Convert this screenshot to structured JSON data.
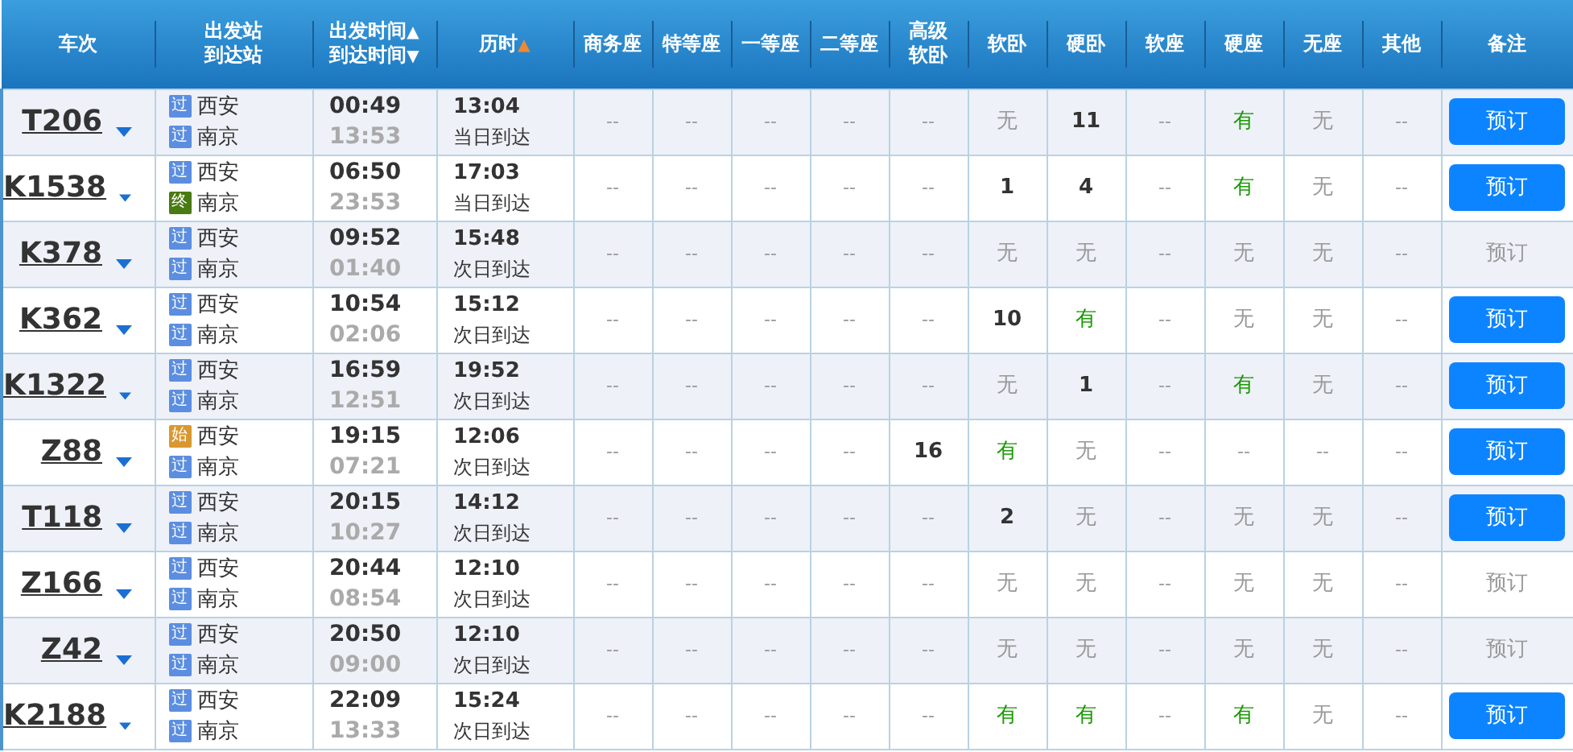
{
  "table": {
    "columns": [
      {
        "lines": [
          {
            "text": "车次"
          }
        ]
      },
      {
        "lines": [
          {
            "text": "出发站"
          },
          {
            "text": "到达站"
          }
        ]
      },
      {
        "lines": [
          {
            "text": "出发时间",
            "sort": "▲",
            "active": false
          },
          {
            "text": "到达时间",
            "sort": "▼",
            "active": false
          }
        ]
      },
      {
        "lines": [
          {
            "text": "历时",
            "sort": "▲",
            "active": true
          }
        ]
      },
      {
        "lines": [
          {
            "text": "商务座"
          }
        ]
      },
      {
        "lines": [
          {
            "text": "特等座"
          }
        ]
      },
      {
        "lines": [
          {
            "text": "一等座"
          }
        ]
      },
      {
        "lines": [
          {
            "text": "二等座"
          }
        ]
      },
      {
        "lines": [
          {
            "text": "高级"
          },
          {
            "text": "软卧"
          }
        ]
      },
      {
        "lines": [
          {
            "text": "软卧"
          }
        ]
      },
      {
        "lines": [
          {
            "text": "硬卧"
          }
        ]
      },
      {
        "lines": [
          {
            "text": "软座"
          }
        ]
      },
      {
        "lines": [
          {
            "text": "硬座"
          }
        ]
      },
      {
        "lines": [
          {
            "text": "无座"
          }
        ]
      },
      {
        "lines": [
          {
            "text": "其他"
          }
        ]
      },
      {
        "lines": [
          {
            "text": "备注"
          }
        ]
      }
    ],
    "rows": [
      {
        "train": "T206",
        "from": {
          "badge": "过",
          "kind": "pass",
          "name": "西安"
        },
        "to": {
          "badge": "过",
          "kind": "pass",
          "name": "南京"
        },
        "depart": "00:49",
        "arrive": "13:53",
        "duration": "13:04",
        "arrival_day": "当日到达",
        "seats": [
          {
            "text": "--",
            "kind": "none"
          },
          {
            "text": "--",
            "kind": "none"
          },
          {
            "text": "--",
            "kind": "none"
          },
          {
            "text": "--",
            "kind": "none"
          },
          {
            "text": "--",
            "kind": "none"
          },
          {
            "text": "无",
            "kind": "soldout"
          },
          {
            "text": "11",
            "kind": "count"
          },
          {
            "text": "--",
            "kind": "none"
          },
          {
            "text": "有",
            "kind": "available"
          },
          {
            "text": "无",
            "kind": "soldout"
          },
          {
            "text": "--",
            "kind": "none"
          }
        ],
        "book": {
          "label": "预订",
          "disabled": false
        }
      },
      {
        "train": "K1538",
        "from": {
          "badge": "过",
          "kind": "pass",
          "name": "西安"
        },
        "to": {
          "badge": "终",
          "kind": "end",
          "name": "南京"
        },
        "depart": "06:50",
        "arrive": "23:53",
        "duration": "17:03",
        "arrival_day": "当日到达",
        "seats": [
          {
            "text": "--",
            "kind": "none"
          },
          {
            "text": "--",
            "kind": "none"
          },
          {
            "text": "--",
            "kind": "none"
          },
          {
            "text": "--",
            "kind": "none"
          },
          {
            "text": "--",
            "kind": "none"
          },
          {
            "text": "1",
            "kind": "count"
          },
          {
            "text": "4",
            "kind": "count"
          },
          {
            "text": "--",
            "kind": "none"
          },
          {
            "text": "有",
            "kind": "available"
          },
          {
            "text": "无",
            "kind": "soldout"
          },
          {
            "text": "--",
            "kind": "none"
          }
        ],
        "book": {
          "label": "预订",
          "disabled": false
        }
      },
      {
        "train": "K378",
        "from": {
          "badge": "过",
          "kind": "pass",
          "name": "西安"
        },
        "to": {
          "badge": "过",
          "kind": "pass",
          "name": "南京"
        },
        "depart": "09:52",
        "arrive": "01:40",
        "duration": "15:48",
        "arrival_day": "次日到达",
        "seats": [
          {
            "text": "--",
            "kind": "none"
          },
          {
            "text": "--",
            "kind": "none"
          },
          {
            "text": "--",
            "kind": "none"
          },
          {
            "text": "--",
            "kind": "none"
          },
          {
            "text": "--",
            "kind": "none"
          },
          {
            "text": "无",
            "kind": "soldout"
          },
          {
            "text": "无",
            "kind": "soldout"
          },
          {
            "text": "--",
            "kind": "none"
          },
          {
            "text": "无",
            "kind": "soldout"
          },
          {
            "text": "无",
            "kind": "soldout"
          },
          {
            "text": "--",
            "kind": "none"
          }
        ],
        "book": {
          "label": "预订",
          "disabled": true
        }
      },
      {
        "train": "K362",
        "from": {
          "badge": "过",
          "kind": "pass",
          "name": "西安"
        },
        "to": {
          "badge": "过",
          "kind": "pass",
          "name": "南京"
        },
        "depart": "10:54",
        "arrive": "02:06",
        "duration": "15:12",
        "arrival_day": "次日到达",
        "seats": [
          {
            "text": "--",
            "kind": "none"
          },
          {
            "text": "--",
            "kind": "none"
          },
          {
            "text": "--",
            "kind": "none"
          },
          {
            "text": "--",
            "kind": "none"
          },
          {
            "text": "--",
            "kind": "none"
          },
          {
            "text": "10",
            "kind": "count"
          },
          {
            "text": "有",
            "kind": "available"
          },
          {
            "text": "--",
            "kind": "none"
          },
          {
            "text": "无",
            "kind": "soldout"
          },
          {
            "text": "无",
            "kind": "soldout"
          },
          {
            "text": "--",
            "kind": "none"
          }
        ],
        "book": {
          "label": "预订",
          "disabled": false
        }
      },
      {
        "train": "K1322",
        "from": {
          "badge": "过",
          "kind": "pass",
          "name": "西安"
        },
        "to": {
          "badge": "过",
          "kind": "pass",
          "name": "南京"
        },
        "depart": "16:59",
        "arrive": "12:51",
        "duration": "19:52",
        "arrival_day": "次日到达",
        "seats": [
          {
            "text": "--",
            "kind": "none"
          },
          {
            "text": "--",
            "kind": "none"
          },
          {
            "text": "--",
            "kind": "none"
          },
          {
            "text": "--",
            "kind": "none"
          },
          {
            "text": "--",
            "kind": "none"
          },
          {
            "text": "无",
            "kind": "soldout"
          },
          {
            "text": "1",
            "kind": "count"
          },
          {
            "text": "--",
            "kind": "none"
          },
          {
            "text": "有",
            "kind": "available"
          },
          {
            "text": "无",
            "kind": "soldout"
          },
          {
            "text": "--",
            "kind": "none"
          }
        ],
        "book": {
          "label": "预订",
          "disabled": false
        }
      },
      {
        "train": "Z88",
        "from": {
          "badge": "始",
          "kind": "start",
          "name": "西安"
        },
        "to": {
          "badge": "过",
          "kind": "pass",
          "name": "南京"
        },
        "depart": "19:15",
        "arrive": "07:21",
        "duration": "12:06",
        "arrival_day": "次日到达",
        "seats": [
          {
            "text": "--",
            "kind": "none"
          },
          {
            "text": "--",
            "kind": "none"
          },
          {
            "text": "--",
            "kind": "none"
          },
          {
            "text": "--",
            "kind": "none"
          },
          {
            "text": "16",
            "kind": "count"
          },
          {
            "text": "有",
            "kind": "available"
          },
          {
            "text": "无",
            "kind": "soldout"
          },
          {
            "text": "--",
            "kind": "none"
          },
          {
            "text": "--",
            "kind": "none"
          },
          {
            "text": "--",
            "kind": "none"
          },
          {
            "text": "--",
            "kind": "none"
          }
        ],
        "book": {
          "label": "预订",
          "disabled": false
        }
      },
      {
        "train": "T118",
        "from": {
          "badge": "过",
          "kind": "pass",
          "name": "西安"
        },
        "to": {
          "badge": "过",
          "kind": "pass",
          "name": "南京"
        },
        "depart": "20:15",
        "arrive": "10:27",
        "duration": "14:12",
        "arrival_day": "次日到达",
        "seats": [
          {
            "text": "--",
            "kind": "none"
          },
          {
            "text": "--",
            "kind": "none"
          },
          {
            "text": "--",
            "kind": "none"
          },
          {
            "text": "--",
            "kind": "none"
          },
          {
            "text": "--",
            "kind": "none"
          },
          {
            "text": "2",
            "kind": "count"
          },
          {
            "text": "无",
            "kind": "soldout"
          },
          {
            "text": "--",
            "kind": "none"
          },
          {
            "text": "无",
            "kind": "soldout"
          },
          {
            "text": "无",
            "kind": "soldout"
          },
          {
            "text": "--",
            "kind": "none"
          }
        ],
        "book": {
          "label": "预订",
          "disabled": false
        }
      },
      {
        "train": "Z166",
        "from": {
          "badge": "过",
          "kind": "pass",
          "name": "西安"
        },
        "to": {
          "badge": "过",
          "kind": "pass",
          "name": "南京"
        },
        "depart": "20:44",
        "arrive": "08:54",
        "duration": "12:10",
        "arrival_day": "次日到达",
        "seats": [
          {
            "text": "--",
            "kind": "none"
          },
          {
            "text": "--",
            "kind": "none"
          },
          {
            "text": "--",
            "kind": "none"
          },
          {
            "text": "--",
            "kind": "none"
          },
          {
            "text": "--",
            "kind": "none"
          },
          {
            "text": "无",
            "kind": "soldout"
          },
          {
            "text": "无",
            "kind": "soldout"
          },
          {
            "text": "--",
            "kind": "none"
          },
          {
            "text": "无",
            "kind": "soldout"
          },
          {
            "text": "无",
            "kind": "soldout"
          },
          {
            "text": "--",
            "kind": "none"
          }
        ],
        "book": {
          "label": "预订",
          "disabled": true
        }
      },
      {
        "train": "Z42",
        "from": {
          "badge": "过",
          "kind": "pass",
          "name": "西安"
        },
        "to": {
          "badge": "过",
          "kind": "pass",
          "name": "南京"
        },
        "depart": "20:50",
        "arrive": "09:00",
        "duration": "12:10",
        "arrival_day": "次日到达",
        "seats": [
          {
            "text": "--",
            "kind": "none"
          },
          {
            "text": "--",
            "kind": "none"
          },
          {
            "text": "--",
            "kind": "none"
          },
          {
            "text": "--",
            "kind": "none"
          },
          {
            "text": "--",
            "kind": "none"
          },
          {
            "text": "无",
            "kind": "soldout"
          },
          {
            "text": "无",
            "kind": "soldout"
          },
          {
            "text": "--",
            "kind": "none"
          },
          {
            "text": "无",
            "kind": "soldout"
          },
          {
            "text": "无",
            "kind": "soldout"
          },
          {
            "text": "--",
            "kind": "none"
          }
        ],
        "book": {
          "label": "预订",
          "disabled": true
        }
      },
      {
        "train": "K2188",
        "from": {
          "badge": "过",
          "kind": "pass",
          "name": "西安"
        },
        "to": {
          "badge": "过",
          "kind": "pass",
          "name": "南京"
        },
        "depart": "22:09",
        "arrive": "13:33",
        "duration": "15:24",
        "arrival_day": "次日到达",
        "seats": [
          {
            "text": "--",
            "kind": "none"
          },
          {
            "text": "--",
            "kind": "none"
          },
          {
            "text": "--",
            "kind": "none"
          },
          {
            "text": "--",
            "kind": "none"
          },
          {
            "text": "--",
            "kind": "none"
          },
          {
            "text": "有",
            "kind": "available"
          },
          {
            "text": "有",
            "kind": "available"
          },
          {
            "text": "--",
            "kind": "none"
          },
          {
            "text": "有",
            "kind": "available"
          },
          {
            "text": "无",
            "kind": "soldout"
          },
          {
            "text": "--",
            "kind": "none"
          }
        ],
        "book": {
          "label": "预订",
          "disabled": false
        }
      }
    ]
  }
}
